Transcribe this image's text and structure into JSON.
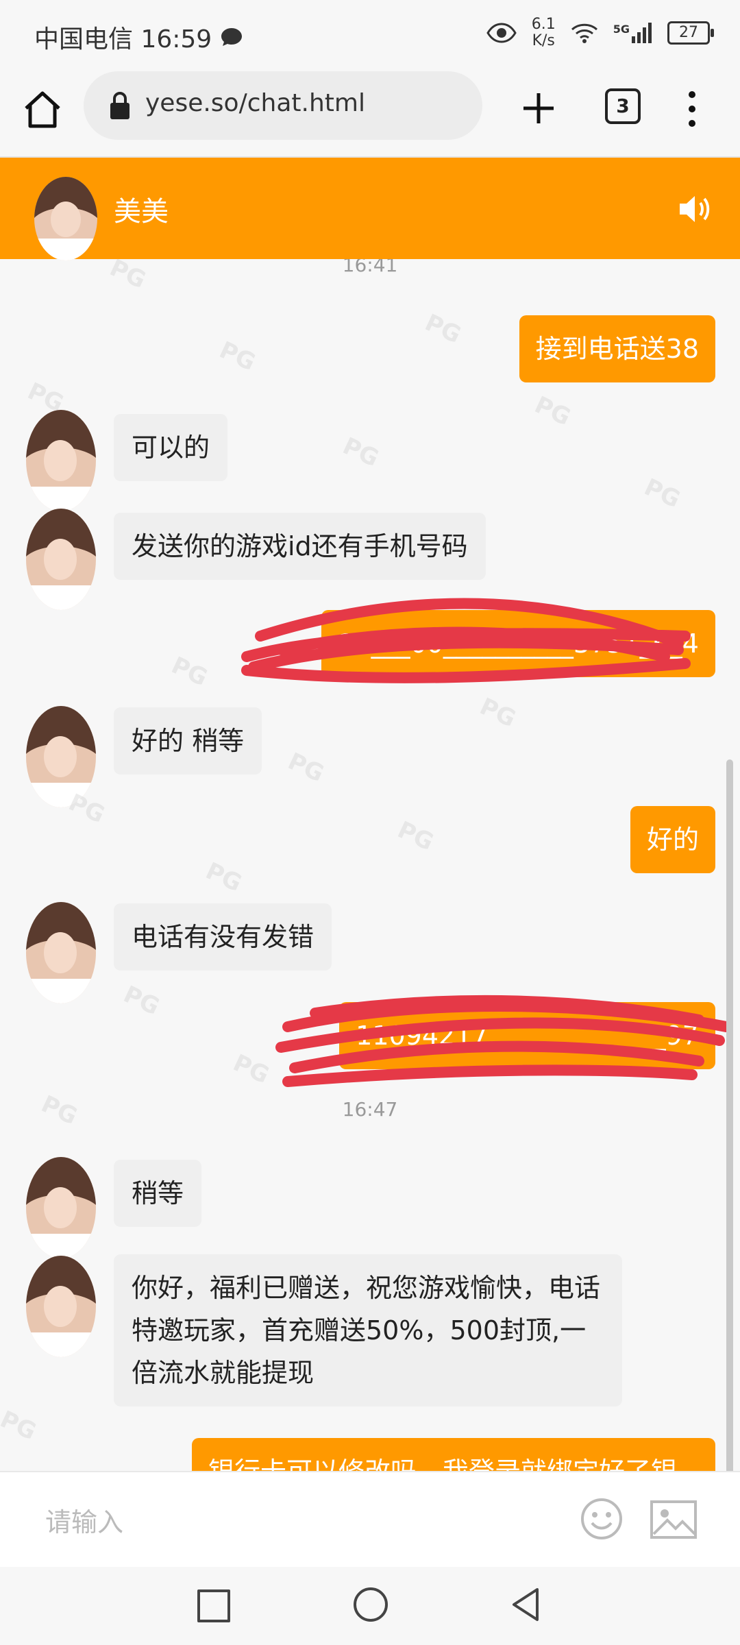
{
  "status_bar": {
    "carrier_time": "中国电信 16:59",
    "net_speed_value": "6.1",
    "net_speed_unit": "K/s",
    "signal_label": "5G",
    "battery": "27"
  },
  "browser": {
    "url": "yese.so/chat.html",
    "tab_count": "3"
  },
  "chat": {
    "contact_name": "美美",
    "messages": [
      {
        "type": "time",
        "text": "16:41"
      },
      {
        "type": "out",
        "text": "接到电话送38"
      },
      {
        "type": "in",
        "text": "可以的"
      },
      {
        "type": "in",
        "text": "发送你的游戏id还有手机号码"
      },
      {
        "type": "out",
        "text": "11___00__________3751_6_4",
        "redacted": true
      },
      {
        "type": "in",
        "text": "好的 稍等"
      },
      {
        "type": "out",
        "text": "好的"
      },
      {
        "type": "in",
        "text": "电话有没有发错"
      },
      {
        "type": "out",
        "text": "11094217,_____________97",
        "redacted": true
      },
      {
        "type": "time",
        "text": "16:47"
      },
      {
        "type": "in",
        "text": "稍等"
      },
      {
        "type": "in",
        "text": "你好，福利已赠送，祝您游戏愉快，电话特邀玩家，首充赠送50%，500封顶,一倍流水就能提现"
      },
      {
        "type": "out",
        "text": "银行卡可以修改吗，我登录就绑定好了银"
      }
    ]
  },
  "input": {
    "placeholder": "请输入"
  },
  "watermark": "PG"
}
